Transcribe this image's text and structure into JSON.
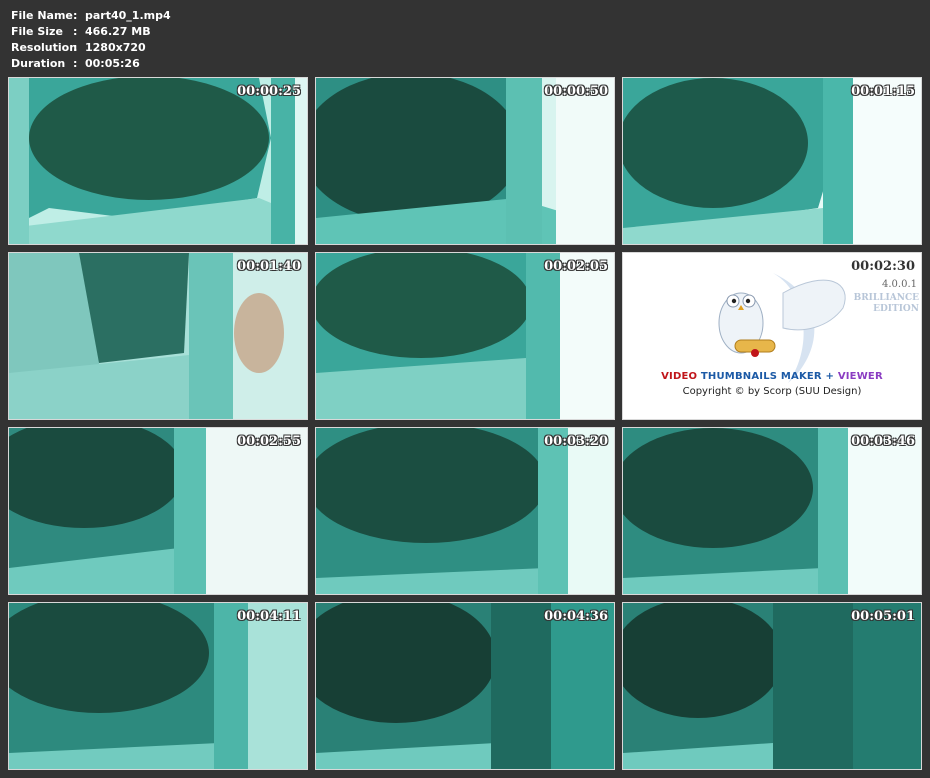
{
  "file_info": [
    {
      "label": "File Name",
      "sep": ":",
      "value": "part40_1.mp4"
    },
    {
      "label": "File Size",
      "sep": ":",
      "value": "466.27 MB"
    },
    {
      "label": "Resolution",
      "sep": ":",
      "value": "1280x720"
    },
    {
      "label": "Duration",
      "sep": ":",
      "value": "00:05:26"
    }
  ],
  "thumbnails": [
    {
      "timestamp": "00:00:25"
    },
    {
      "timestamp": "00:00:50"
    },
    {
      "timestamp": "00:01:15"
    },
    {
      "timestamp": "00:01:40"
    },
    {
      "timestamp": "00:02:05"
    },
    {
      "timestamp": "00:02:30"
    },
    {
      "timestamp": "00:02:55"
    },
    {
      "timestamp": "00:03:20"
    },
    {
      "timestamp": "00:03:46"
    },
    {
      "timestamp": "00:04:11"
    },
    {
      "timestamp": "00:04:36"
    },
    {
      "timestamp": "00:05:01"
    }
  ],
  "logo": {
    "version": "4.0.0.1",
    "edition_1": "BRILLIANCE",
    "edition_2": "EDITION",
    "title_1": "VIDEO",
    "title_2": "THUMBNAILS MAKER",
    "title_plus": "+",
    "title_3": "VIEWER",
    "copyright": "Copyright © by Scorp (SUU Design)",
    "icon": "owl-with-scroll-icon"
  },
  "colors": {
    "background": "#333333",
    "frame_dark": "#1f5a48",
    "frame_teal": "#3aa69a",
    "frame_light": "#9fe0d6"
  }
}
